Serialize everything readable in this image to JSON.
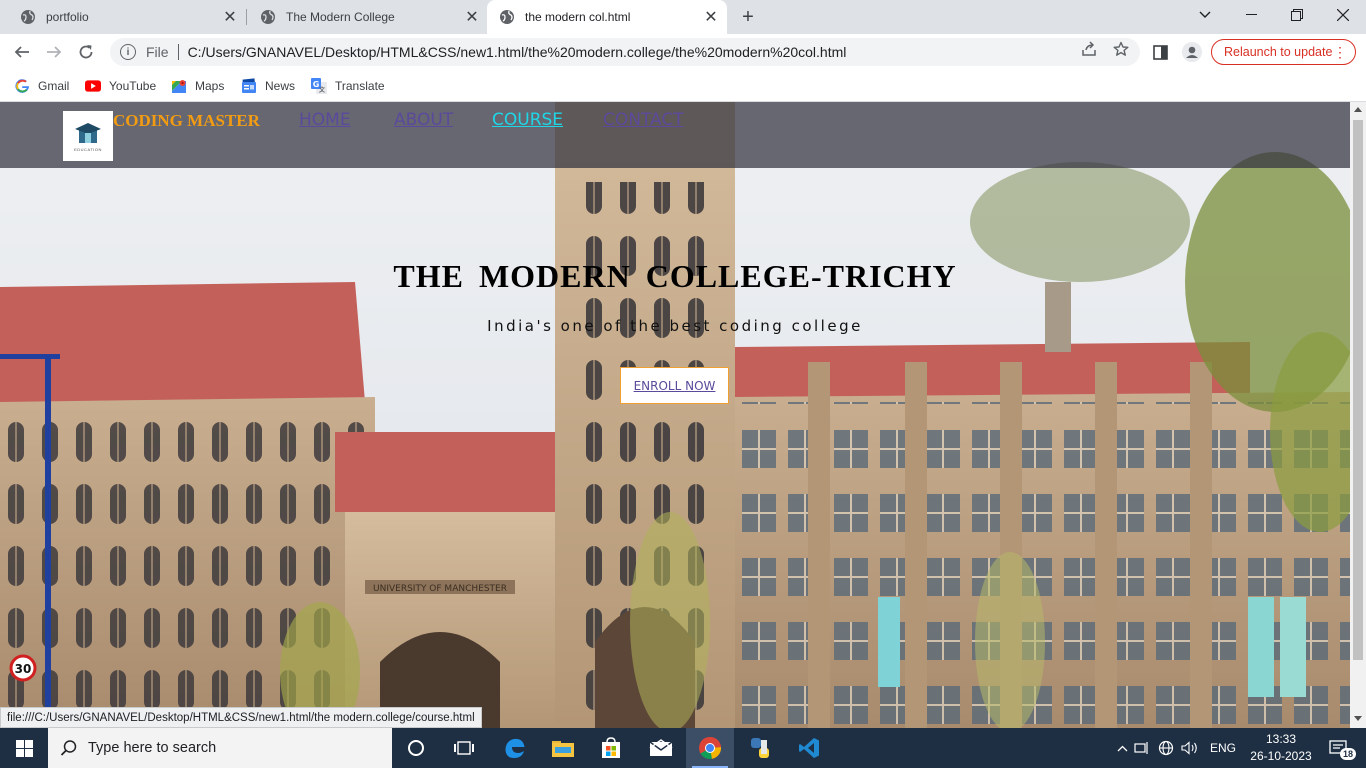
{
  "browser": {
    "tabs": [
      {
        "title": "portfolio"
      },
      {
        "title": "The Modern College"
      },
      {
        "title": "the modern col.html"
      }
    ],
    "omnibox": {
      "scheme_label": "File",
      "url": "C:/Users/GNANAVEL/Desktop/HTML&CSS/new1.html/the%20modern.college/the%20modern%20col.html"
    },
    "relaunch_label": "Relaunch to update",
    "bookmarks": [
      {
        "label": "Gmail",
        "icon": "gmail-icon"
      },
      {
        "label": "YouTube",
        "icon": "youtube-icon"
      },
      {
        "label": "Maps",
        "icon": "maps-icon"
      },
      {
        "label": "News",
        "icon": "news-icon"
      },
      {
        "label": "Translate",
        "icon": "translate-icon"
      }
    ],
    "status_url": "file:///C:/Users/GNANAVEL/Desktop/HTML&CSS/new1.html/the modern.college/course.html"
  },
  "page": {
    "brand": "CODING MASTER",
    "logo_caption": "EDUCATION",
    "nav": [
      {
        "label": "HOME"
      },
      {
        "label": "ABOUT"
      },
      {
        "label": "COURSE"
      },
      {
        "label": "CONTACT"
      }
    ],
    "hero": {
      "title": "THE MODERN COLLEGE-TRICHY",
      "subtitle": "India's one of the best coding college",
      "cta": "ENROLL NOW",
      "sign_text": "UNIVERSITY OF MANCHESTER",
      "speed_sign": "30"
    },
    "colors": {
      "brand": "#f39c12",
      "nav_link": "#5b4a9b",
      "nav_active": "#1ed6e6",
      "navbar_bg": "#32323e"
    }
  },
  "taskbar": {
    "search_placeholder": "Type here to search",
    "language": "ENG",
    "time": "13:33",
    "date": "26-10-2023",
    "notification_count": "18"
  }
}
